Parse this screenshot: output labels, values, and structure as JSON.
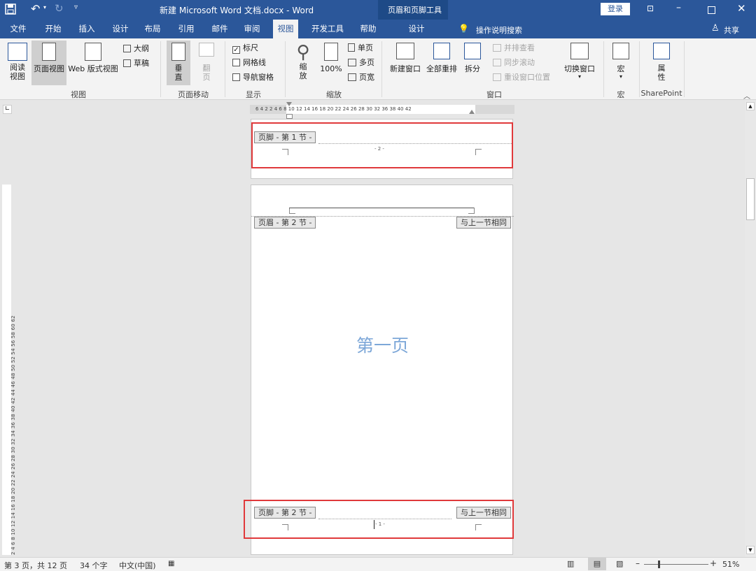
{
  "titlebar": {
    "doc_title": "新建 Microsoft Word 文档.docx - Word",
    "context_title": "页眉和页脚工具",
    "signin": "登录"
  },
  "tabs": [
    "文件",
    "开始",
    "插入",
    "设计",
    "布局",
    "引用",
    "邮件",
    "审阅",
    "视图",
    "开发工具",
    "帮助"
  ],
  "context_tab": "设计",
  "tell_me": "操作说明搜索",
  "share": "共享",
  "ribbon": {
    "view": {
      "read": "阅读\n视图",
      "print": "页面视图",
      "web": "Web 版式视图",
      "outline": "大纲",
      "draft": "草稿",
      "label": "视图"
    },
    "pagemove": {
      "vertical": "垂\n直",
      "side": "翻\n页",
      "label": "页面移动"
    },
    "show": {
      "ruler": "标尺",
      "grid": "网格线",
      "nav": "导航窗格",
      "label": "显示"
    },
    "zoom": {
      "zoom": "缩\n放",
      "pct": "100%",
      "one": "单页",
      "multi": "多页",
      "width": "页宽",
      "label": "缩放"
    },
    "window": {
      "new": "新建窗口",
      "arrange": "全部重排",
      "split": "拆分",
      "side": "并排查看",
      "sync": "同步滚动",
      "reset": "重设窗口位置",
      "switch": "切换窗口",
      "label": "窗口"
    },
    "macro": {
      "btn": "宏",
      "label": "宏"
    },
    "sp": {
      "btn": "属\n性",
      "label": "SharePoint"
    }
  },
  "ruler_text": "6  4  2     2  4  6  8  10  12  14  16  18  20  22  24  26  28  30  32     36  38  40  42",
  "vruler_text": "2  4  6  8  10  12  14  16  18  20  22  24  26  28  30  32  34  36  38  40  42  44  46  48  50  52  54  56  58  60  62",
  "doc": {
    "footer1_tag": "页脚 - 第 1 节 -",
    "footer1_num": "- 2 -",
    "header2_tag": "页眉 - 第 2 节 -",
    "same_as_prev": "与上一节相同",
    "body_text": "第一页",
    "footer2_tag": "页脚 - 第 2 节 -",
    "footer2_num": "- 1 -"
  },
  "status": {
    "page": "第 3 页，共 12 页",
    "words": "34 个字",
    "lang": "中文(中国)",
    "zoom": "51%"
  },
  "colors": {
    "brand": "#2b579a",
    "body_text": "#7da7d8",
    "highlight": "#e0393b"
  }
}
